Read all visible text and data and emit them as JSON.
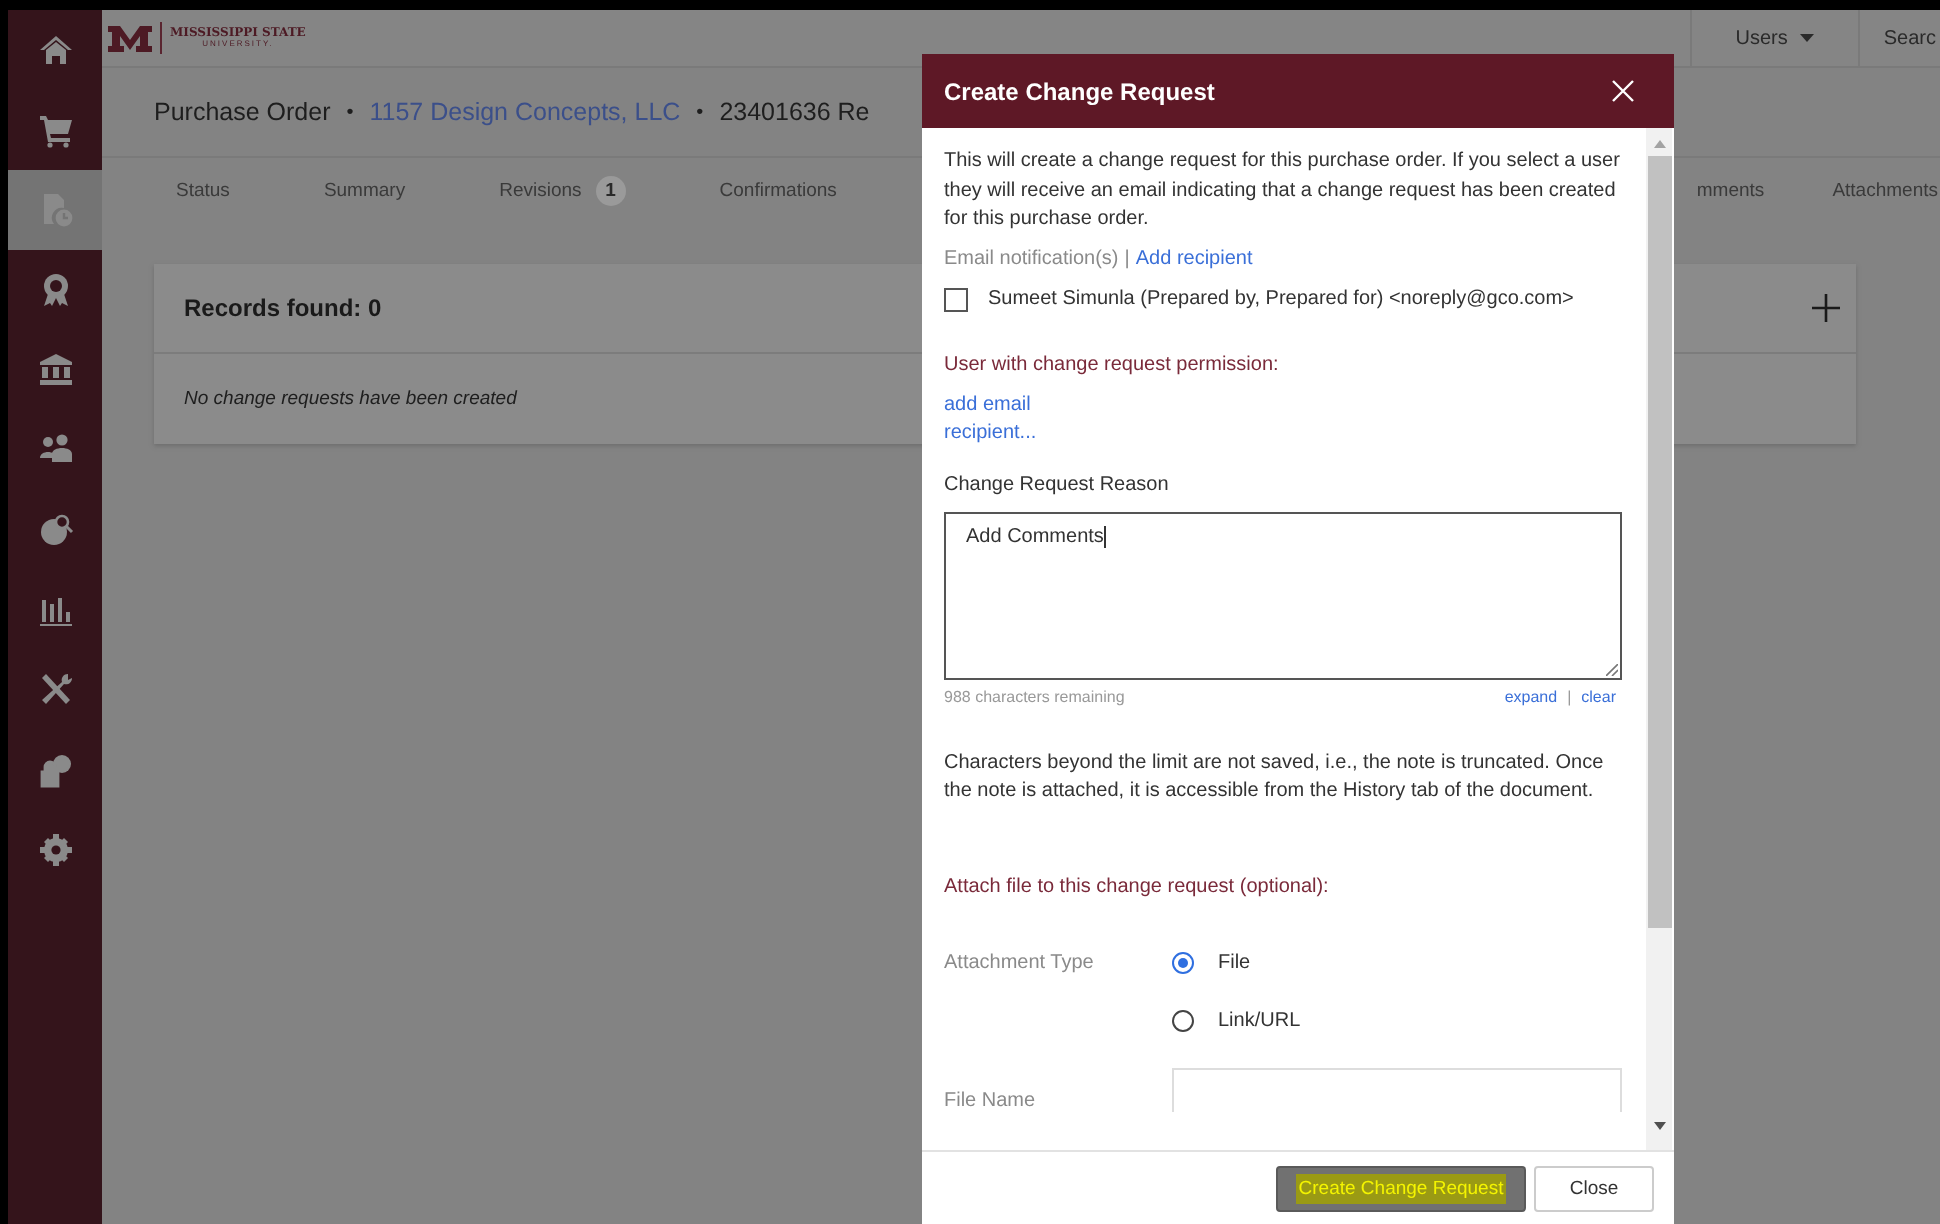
{
  "sidebar": {
    "items": [
      {
        "selected": false
      },
      {
        "selected": false
      },
      {
        "selected": true
      },
      {
        "selected": false
      },
      {
        "selected": false
      },
      {
        "selected": false
      },
      {
        "selected": false
      },
      {
        "selected": false
      },
      {
        "selected": false
      },
      {
        "selected": false
      },
      {
        "selected": false
      }
    ]
  },
  "top_bar": {
    "logo_title": "MISSISSIPPI STATE",
    "logo_subtitle": "UNIVERSITY.",
    "users_menu": "Users",
    "search": "Searc"
  },
  "page_title": [
    {
      "text": "Purchase Order",
      "kind": "plain"
    },
    {
      "text": "•",
      "kind": "separator"
    },
    {
      "text": "1157 Design Concepts, LLC",
      "kind": "link"
    },
    {
      "text": "•",
      "kind": "separator"
    },
    {
      "text": "23401636 Re",
      "kind": "plain"
    }
  ],
  "tabs": [
    {
      "label": "Status",
      "selected": false
    },
    {
      "label": "Summary",
      "selected": false
    },
    {
      "label": "Revisions",
      "badge": "1",
      "selected": false
    },
    {
      "label": "Confirmations",
      "selected": false
    },
    {
      "label": "mments",
      "selected": false
    },
    {
      "label": "Attachments",
      "selected": false
    }
  ],
  "records": {
    "title": "Records found: 0",
    "empty_message": "No change requests have been created"
  },
  "dialog": {
    "title": "Create Change Request",
    "intro": "This will create a change request for this purchase order. If you select a user they will receive an email indicating that a change request has been created for this purchase order.",
    "email_label": "Email notification(s)",
    "email_separator": "|",
    "add_recipient_link": "Add recipient",
    "recipients": [
      {
        "label": "Sumeet Simunla (Prepared by, Prepared for) <noreply@gco.com>",
        "checked": false
      }
    ],
    "permission_heading": "User with change request permission:",
    "add_email_link": "add email recipient...",
    "reason_label": "Change Request Reason",
    "reason_value": "Add Comments",
    "chars_remaining": "988 characters remaining",
    "expand_link": "expand",
    "link_separator": "|",
    "clear_link": "clear",
    "note": "Characters beyond the limit are not saved, i.e., the note is truncated. Once the note is attached, it is accessible from the History tab of the document.",
    "attach_heading": "Attach file to this change request (optional):",
    "attachment_type_label": "Attachment Type",
    "attachment_options": [
      {
        "label": "File",
        "selected": true
      },
      {
        "label": "Link/URL",
        "selected": false
      }
    ],
    "file_name_label": "File Name",
    "buttons": [
      {
        "label": "Create Change Request",
        "kind": "primary"
      },
      {
        "label": "Close",
        "kind": "secondary"
      }
    ]
  }
}
